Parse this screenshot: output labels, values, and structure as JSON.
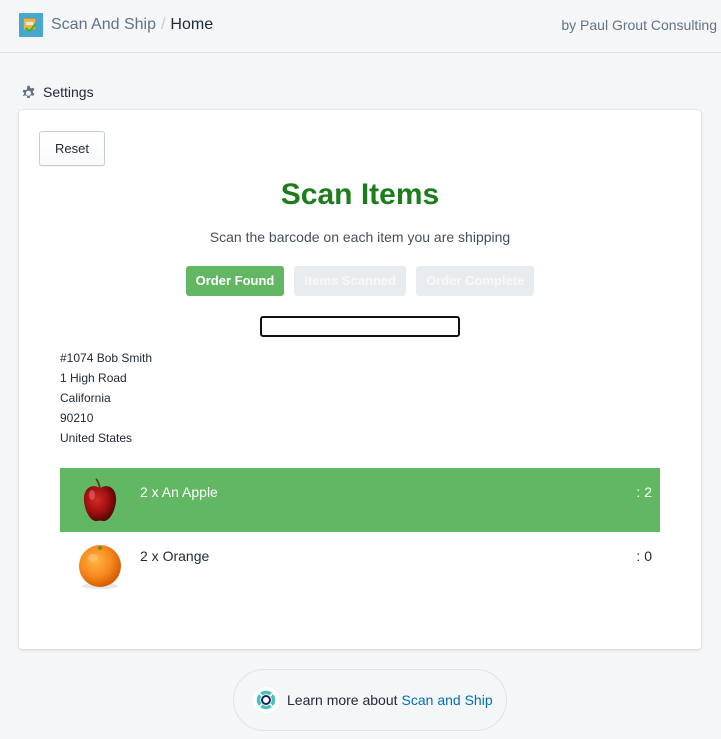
{
  "header": {
    "app_name": "Scan And Ship",
    "separator": "/",
    "page": "Home",
    "byline": "by Paul Grout Consulting",
    "logo_icon": "scan-and-ship-logo"
  },
  "settings": {
    "label": "Settings",
    "icon": "gear-icon"
  },
  "card": {
    "reset_label": "Reset",
    "title": "Scan Items",
    "subtitle": "Scan the barcode on each item you are shipping",
    "steps": [
      {
        "label": "Order Found",
        "state": "active"
      },
      {
        "label": "Items Scanned",
        "state": "inactive"
      },
      {
        "label": "Order Complete",
        "state": "inactive"
      }
    ],
    "scan_input": {
      "value": "",
      "placeholder": ""
    },
    "address": {
      "order_line": "#1074 Bob Smith",
      "street": "1 High Road",
      "region": "California",
      "postcode": "90210",
      "country": "United States"
    },
    "items": [
      {
        "label": "2 x An Apple",
        "scanned_count": ": 2",
        "image": "apple-image",
        "status": "scanned"
      },
      {
        "label": "2 x Orange",
        "scanned_count": ": 0",
        "image": "orange-image",
        "status": "pending"
      }
    ]
  },
  "footer": {
    "learn_prefix": "Learn more about",
    "learn_link": "Scan and Ship",
    "icon": "help-lifebuoy-icon"
  },
  "colors": {
    "title_green": "#1d7c1d",
    "active_step": "#62b862",
    "scanned_row": "#62b862",
    "link_blue": "#006fbb"
  }
}
